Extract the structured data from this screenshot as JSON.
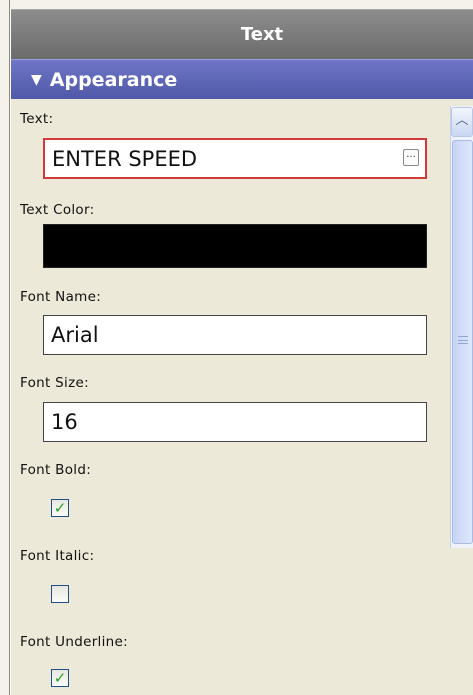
{
  "panel": {
    "title": "Text"
  },
  "section": {
    "title": "Appearance",
    "expanded": true
  },
  "properties": {
    "text": {
      "label": "Text:",
      "value": "ENTER SPEED",
      "browse_label": "..."
    },
    "text_color": {
      "label": "Text Color:",
      "value": "#000000"
    },
    "font_name": {
      "label": "Font Name:",
      "value": "Arial"
    },
    "font_size": {
      "label": "Font Size:",
      "value": "16"
    },
    "font_bold": {
      "label": "Font Bold:",
      "checked": true
    },
    "font_italic": {
      "label": "Font Italic:",
      "checked": false
    },
    "font_underline": {
      "label": "Font Underline:",
      "checked": true
    }
  },
  "icons": {
    "collapse": "triangle-down-icon",
    "scroll_up": "chevron-up-icon",
    "check": "checkmark-icon"
  }
}
